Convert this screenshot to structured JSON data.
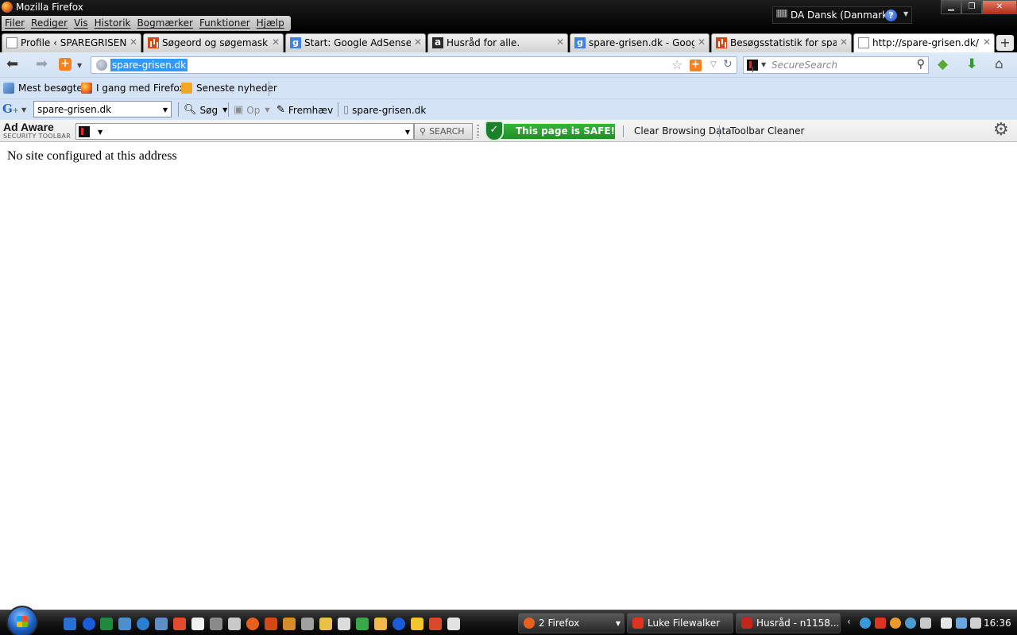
{
  "window": {
    "title": "Mozilla Firefox"
  },
  "menu": [
    "Filer",
    "Rediger",
    "Vis",
    "Historik",
    "Bogmærker",
    "Funktioner",
    "Hjælp"
  ],
  "language": {
    "label": "DA Dansk (Danmark)",
    "help": "?"
  },
  "tabs": [
    {
      "label": "Profile ‹ SPAREGRISENs ...",
      "icon": "blank-page-icon"
    },
    {
      "label": "Søgeord og søgemaski...",
      "icon": "stats-icon"
    },
    {
      "label": "Start: Google AdSense",
      "icon": "google-icon"
    },
    {
      "label": "Husråd for alle.",
      "icon": "a-icon"
    },
    {
      "label": "spare-grisen.dk - Googl...",
      "icon": "google-icon"
    },
    {
      "label": "Besøgsstatistik for spare...",
      "icon": "stats-icon"
    },
    {
      "label": "http://spare-grisen.dk/",
      "icon": "blank-page-icon"
    }
  ],
  "nav": {
    "url": "spare-grisen.dk",
    "search_placeholder": "SecureSearch"
  },
  "bookmarks": [
    "Mest besøgte",
    "I gang med Firefox",
    "Seneste nyheder"
  ],
  "google_toolbar": {
    "combo": "spare-grisen.dk",
    "search": "Søg",
    "up": "Op",
    "highlight": "Fremhæv",
    "page": "spare-grisen.dk"
  },
  "adaware": {
    "logo": "Ad Aware",
    "subtitle": "SECURITY TOOLBAR",
    "search": "SEARCH",
    "safe": "This page is SAFE!",
    "clear": "Clear Browsing Data",
    "cleaner": "Toolbar Cleaner"
  },
  "content": {
    "message": "No site configured at this address"
  },
  "taskbar": {
    "buttons": [
      {
        "label": "2 Firefox",
        "color": "#e8601c"
      },
      {
        "label": "Luke Filewalker",
        "color": "#d9361c"
      },
      {
        "label": "Husråd - n1158...",
        "color": "#c1271a"
      }
    ],
    "clock": "16:36"
  }
}
